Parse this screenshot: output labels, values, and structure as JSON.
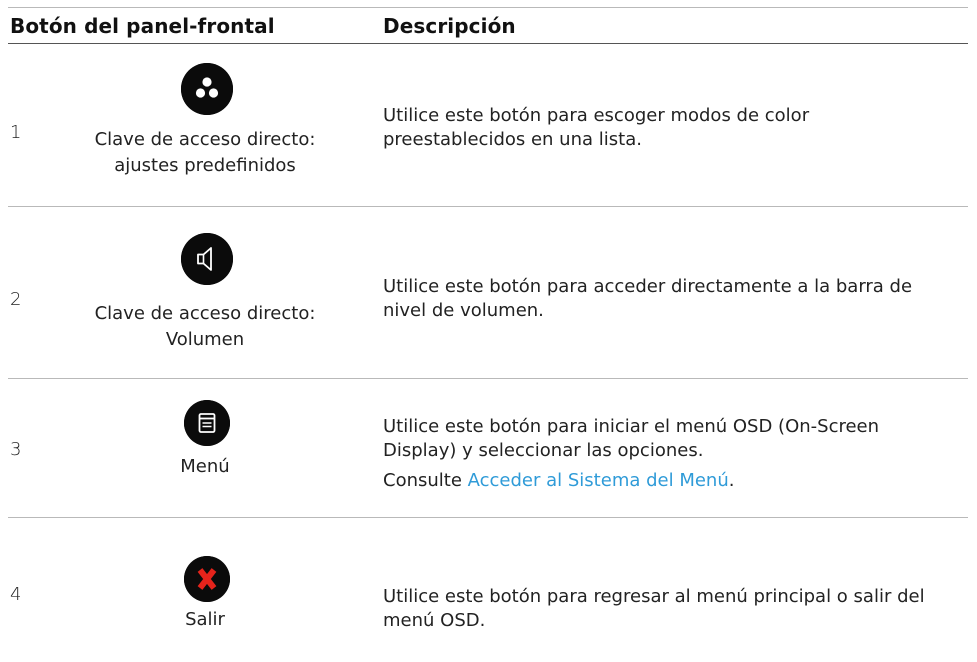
{
  "table": {
    "headers": {
      "button": "Botón del panel-frontal",
      "description": "Descripción"
    },
    "rows": [
      {
        "number": "1",
        "icon": "preset-modes-icon",
        "label_line1": "Clave de acceso directo:",
        "label_line2": "ajustes predefinidos",
        "description": "Utilice este botón para escoger modos de color preestablecidos en una lista."
      },
      {
        "number": "2",
        "icon": "speaker-icon",
        "label_line1": "Clave de acceso directo:",
        "label_line2": "Volumen",
        "description": "Utilice este botón para acceder directamente a la barra de nivel de volumen."
      },
      {
        "number": "3",
        "icon": "menu-icon",
        "label_line1": "Menú",
        "description": "Utilice este botón para iniciar el menú OSD (On-Screen Display) y seleccionar las opciones.",
        "note_prefix": "Consulte ",
        "link_text": "Acceder al Sistema del Menú",
        "note_suffix": "."
      },
      {
        "number": "4",
        "icon": "exit-x-icon",
        "label_line1": "Salir",
        "description": "Utilice este botón para regresar al menú principal o salir del menú OSD."
      }
    ]
  },
  "colors": {
    "button_fill": "#0b0b0b",
    "exit_x": "#e5231b",
    "link": "#2f9bd8",
    "rule": "#b9b9b9"
  }
}
